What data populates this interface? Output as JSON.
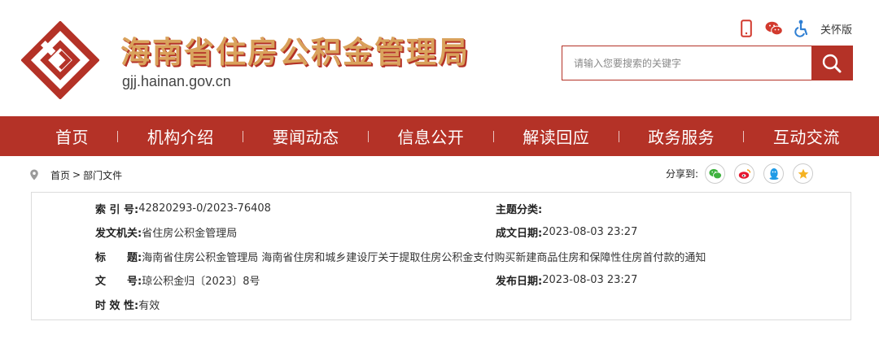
{
  "header": {
    "site_title": "海南省住房公积金管理局",
    "site_domain": "gjj.hainan.gov.cn",
    "tools": [
      {
        "icon": "mobile-phone-icon"
      },
      {
        "icon": "wechat-icon"
      },
      {
        "icon": "accessibility-icon"
      }
    ],
    "care_mode_label": "关怀版",
    "search": {
      "placeholder": "请输入您要搜索的关键字",
      "value": "",
      "button_icon": "search-icon"
    }
  },
  "nav": {
    "items": [
      {
        "label": "首页"
      },
      {
        "label": "机构介绍"
      },
      {
        "label": "要闻动态"
      },
      {
        "label": "信息公开"
      },
      {
        "label": "解读回应"
      },
      {
        "label": "政务服务"
      },
      {
        "label": "互动交流"
      }
    ]
  },
  "breadcrumb": {
    "home": "首页",
    "separator": ">",
    "current": "部门文件"
  },
  "share": {
    "label": "分享到:",
    "targets": [
      {
        "icon": "wechat-share-icon",
        "color": "#3fb23f"
      },
      {
        "icon": "weibo-share-icon",
        "color": "#e6162d"
      },
      {
        "icon": "qq-share-icon",
        "color": "#1f9be6"
      },
      {
        "icon": "qzone-share-icon",
        "color": "#f5b323"
      }
    ]
  },
  "meta": {
    "index_no": {
      "label": "索 引 号:",
      "value": "42820293-0/2023-76408"
    },
    "subject": {
      "label": "主题分类:",
      "value": ""
    },
    "issuer": {
      "label": "发文机关:",
      "value": "省住房公积金管理局"
    },
    "created_date": {
      "label": "成文日期:",
      "value": "2023-08-03 23:27"
    },
    "title": {
      "label": "标　　题:",
      "value": "海南省住房公积金管理局 海南省住房和城乡建设厅关于提取住房公积金支付购买新建商品住房和保障性住房首付款的通知"
    },
    "doc_no": {
      "label": "文　　号:",
      "value": "琼公积金归〔2023〕8号"
    },
    "publish_date": {
      "label": "发布日期:",
      "value": "2023-08-03 23:27"
    },
    "validity": {
      "label": "时 效 性:",
      "value": "有效"
    }
  },
  "colors": {
    "brand_red": "#b43227",
    "title_gold": "#d9a25c"
  }
}
